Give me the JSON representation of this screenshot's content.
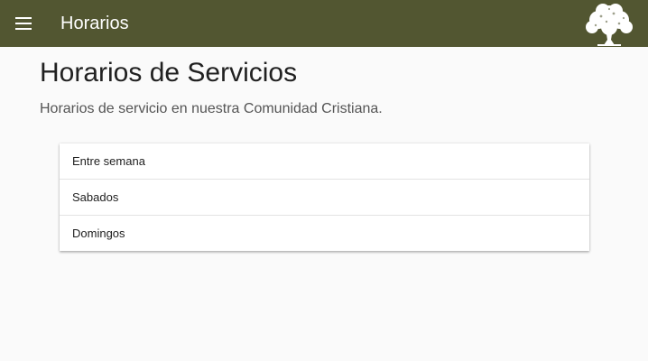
{
  "toolbar": {
    "title": "Horarios",
    "menu_icon": "hamburger-menu-icon",
    "logo_icon": "tree-logo-icon",
    "background_color": "#525631"
  },
  "page": {
    "title": "Horarios de Servicios",
    "subtitle": "Horarios de servicio en nuestra Comunidad Cristiana."
  },
  "schedule_list": {
    "items": [
      {
        "label": "Entre semana"
      },
      {
        "label": "Sabados"
      },
      {
        "label": "Domingos"
      }
    ]
  }
}
